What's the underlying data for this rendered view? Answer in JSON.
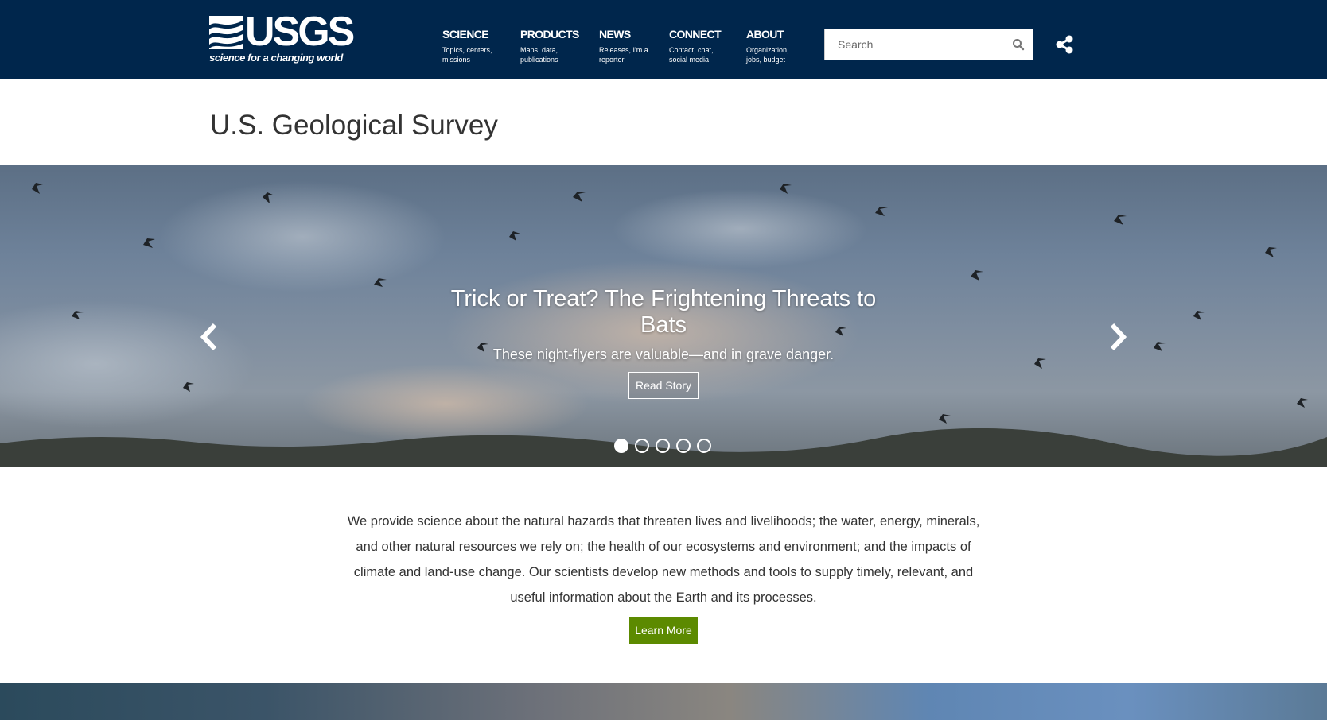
{
  "header": {
    "logo": {
      "wordmark": "USGS",
      "tagline": "science for a changing world"
    },
    "nav": [
      {
        "title": "SCIENCE",
        "sub": "Topics, centers, missions"
      },
      {
        "title": "PRODUCTS",
        "sub": "Maps, data, publications"
      },
      {
        "title": "NEWS",
        "sub": "Releases, I'm a reporter"
      },
      {
        "title": "CONNECT",
        "sub": "Contact, chat, social media"
      },
      {
        "title": "ABOUT",
        "sub": "Organization, jobs, budget"
      }
    ],
    "search": {
      "placeholder": "Search"
    },
    "share_icon": "share-icon",
    "search_icon": "search-icon"
  },
  "page_title": "U.S. Geological Survey",
  "hero": {
    "title": "Trick or Treat? The Frightening Threats to Bats",
    "subtitle": "These night-flyers are valuable—and in grave danger.",
    "button": "Read Story",
    "slides": 5,
    "active_slide": 1,
    "prev_icon": "chevron-left-icon",
    "next_icon": "chevron-right-icon"
  },
  "intro": {
    "text": "We provide science about the natural hazards that threaten lives and livelihoods; the water, energy, minerals, and other natural resources we rely on; the health of our ecosystems and environment; and the impacts of climate and land-use change. Our scientists develop new methods and tools to supply timely, relevant, and useful information about the Earth and its processes.",
    "button": "Learn More"
  },
  "colors": {
    "header_bg": "#00264c",
    "learn_more_bg": "#5c8a00"
  }
}
